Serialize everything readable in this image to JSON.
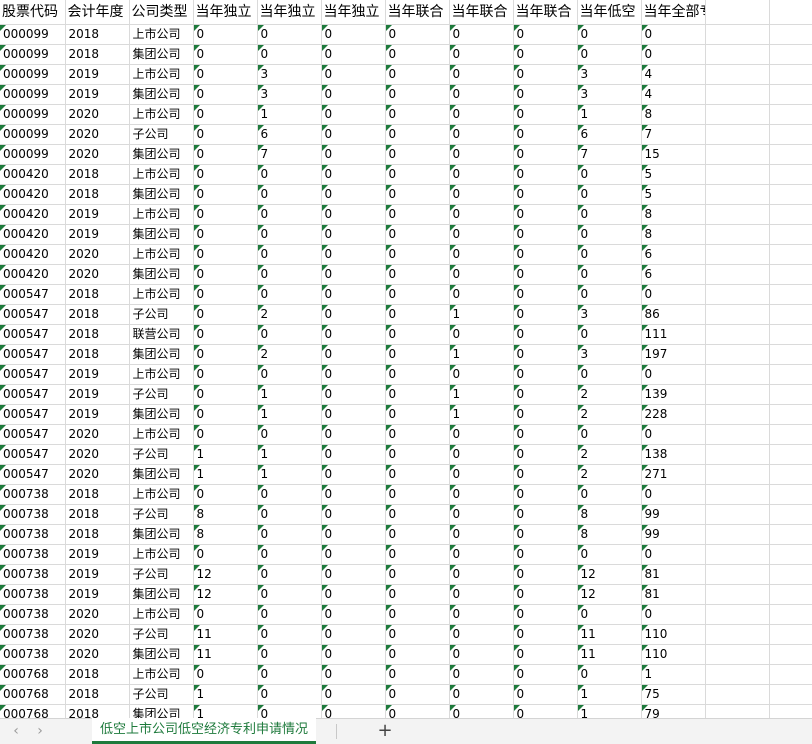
{
  "columns": [
    "股票代码",
    "会计年度",
    "公司类型",
    "当年独立",
    "当年独立",
    "当年独立",
    "当年联合",
    "当年联合",
    "当年联合",
    "当年低空",
    "当年全部专利申请总数",
    "",
    ""
  ],
  "rows": [
    [
      "000099",
      "2018",
      "上市公司",
      "0",
      "0",
      "0",
      "0",
      "0",
      "0",
      "0",
      "0"
    ],
    [
      "000099",
      "2018",
      "集团公司",
      "0",
      "0",
      "0",
      "0",
      "0",
      "0",
      "0",
      "0"
    ],
    [
      "000099",
      "2019",
      "上市公司",
      "0",
      "3",
      "0",
      "0",
      "0",
      "0",
      "3",
      "4"
    ],
    [
      "000099",
      "2019",
      "集团公司",
      "0",
      "3",
      "0",
      "0",
      "0",
      "0",
      "3",
      "4"
    ],
    [
      "000099",
      "2020",
      "上市公司",
      "0",
      "1",
      "0",
      "0",
      "0",
      "0",
      "1",
      "8"
    ],
    [
      "000099",
      "2020",
      "子公司",
      "0",
      "6",
      "0",
      "0",
      "0",
      "0",
      "6",
      "7"
    ],
    [
      "000099",
      "2020",
      "集团公司",
      "0",
      "7",
      "0",
      "0",
      "0",
      "0",
      "7",
      "15"
    ],
    [
      "000420",
      "2018",
      "上市公司",
      "0",
      "0",
      "0",
      "0",
      "0",
      "0",
      "0",
      "5"
    ],
    [
      "000420",
      "2018",
      "集团公司",
      "0",
      "0",
      "0",
      "0",
      "0",
      "0",
      "0",
      "5"
    ],
    [
      "000420",
      "2019",
      "上市公司",
      "0",
      "0",
      "0",
      "0",
      "0",
      "0",
      "0",
      "8"
    ],
    [
      "000420",
      "2019",
      "集团公司",
      "0",
      "0",
      "0",
      "0",
      "0",
      "0",
      "0",
      "8"
    ],
    [
      "000420",
      "2020",
      "上市公司",
      "0",
      "0",
      "0",
      "0",
      "0",
      "0",
      "0",
      "6"
    ],
    [
      "000420",
      "2020",
      "集团公司",
      "0",
      "0",
      "0",
      "0",
      "0",
      "0",
      "0",
      "6"
    ],
    [
      "000547",
      "2018",
      "上市公司",
      "0",
      "0",
      "0",
      "0",
      "0",
      "0",
      "0",
      "0"
    ],
    [
      "000547",
      "2018",
      "子公司",
      "0",
      "2",
      "0",
      "0",
      "1",
      "0",
      "3",
      "86"
    ],
    [
      "000547",
      "2018",
      "联营公司",
      "0",
      "0",
      "0",
      "0",
      "0",
      "0",
      "0",
      "111"
    ],
    [
      "000547",
      "2018",
      "集团公司",
      "0",
      "2",
      "0",
      "0",
      "1",
      "0",
      "3",
      "197"
    ],
    [
      "000547",
      "2019",
      "上市公司",
      "0",
      "0",
      "0",
      "0",
      "0",
      "0",
      "0",
      "0"
    ],
    [
      "000547",
      "2019",
      "子公司",
      "0",
      "1",
      "0",
      "0",
      "1",
      "0",
      "2",
      "139"
    ],
    [
      "000547",
      "2019",
      "集团公司",
      "0",
      "1",
      "0",
      "0",
      "1",
      "0",
      "2",
      "228"
    ],
    [
      "000547",
      "2020",
      "上市公司",
      "0",
      "0",
      "0",
      "0",
      "0",
      "0",
      "0",
      "0"
    ],
    [
      "000547",
      "2020",
      "子公司",
      "1",
      "1",
      "0",
      "0",
      "0",
      "0",
      "2",
      "138"
    ],
    [
      "000547",
      "2020",
      "集团公司",
      "1",
      "1",
      "0",
      "0",
      "0",
      "0",
      "2",
      "271"
    ],
    [
      "000738",
      "2018",
      "上市公司",
      "0",
      "0",
      "0",
      "0",
      "0",
      "0",
      "0",
      "0"
    ],
    [
      "000738",
      "2018",
      "子公司",
      "8",
      "0",
      "0",
      "0",
      "0",
      "0",
      "8",
      "99"
    ],
    [
      "000738",
      "2018",
      "集团公司",
      "8",
      "0",
      "0",
      "0",
      "0",
      "0",
      "8",
      "99"
    ],
    [
      "000738",
      "2019",
      "上市公司",
      "0",
      "0",
      "0",
      "0",
      "0",
      "0",
      "0",
      "0"
    ],
    [
      "000738",
      "2019",
      "子公司",
      "12",
      "0",
      "0",
      "0",
      "0",
      "0",
      "12",
      "81"
    ],
    [
      "000738",
      "2019",
      "集团公司",
      "12",
      "0",
      "0",
      "0",
      "0",
      "0",
      "12",
      "81"
    ],
    [
      "000738",
      "2020",
      "上市公司",
      "0",
      "0",
      "0",
      "0",
      "0",
      "0",
      "0",
      "0"
    ],
    [
      "000738",
      "2020",
      "子公司",
      "11",
      "0",
      "0",
      "0",
      "0",
      "0",
      "11",
      "110"
    ],
    [
      "000738",
      "2020",
      "集团公司",
      "11",
      "0",
      "0",
      "0",
      "0",
      "0",
      "11",
      "110"
    ],
    [
      "000768",
      "2018",
      "上市公司",
      "0",
      "0",
      "0",
      "0",
      "0",
      "0",
      "0",
      "1"
    ],
    [
      "000768",
      "2018",
      "子公司",
      "1",
      "0",
      "0",
      "0",
      "0",
      "0",
      "1",
      "75"
    ],
    [
      "000768",
      "2018",
      "集团公司",
      "1",
      "0",
      "0",
      "0",
      "0",
      "0",
      "1",
      "79"
    ]
  ],
  "tabbar": {
    "prev_label": "‹",
    "next_label": "›",
    "active_sheet": "低空上市公司低空经济专利申请情况",
    "add_label": "+"
  },
  "colors": {
    "accent": "#1e7a3c",
    "gridline": "#dadada"
  }
}
